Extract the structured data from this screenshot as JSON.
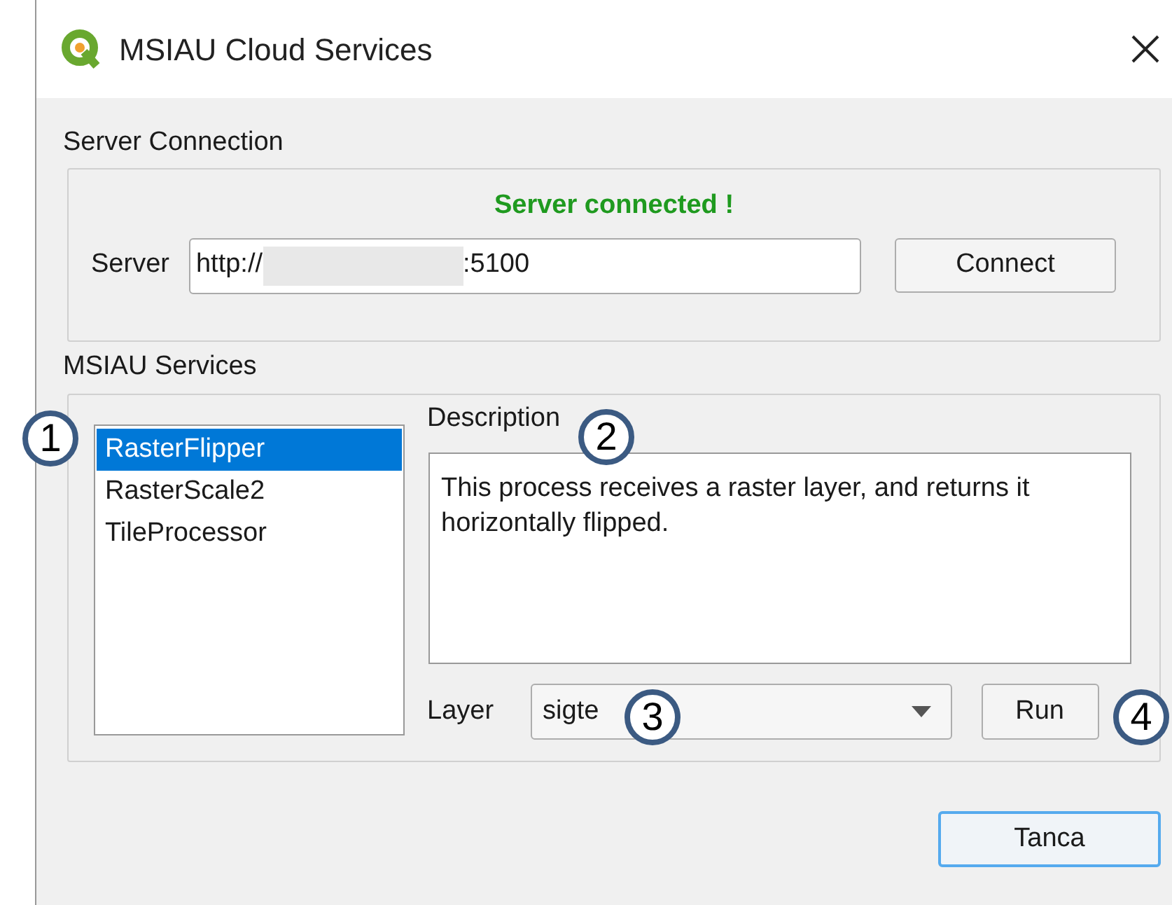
{
  "window": {
    "title": "MSIAU Cloud Services"
  },
  "server_connection": {
    "title": "Server Connection",
    "status": "Server connected !",
    "connected": true,
    "server_label": "Server",
    "server_field": {
      "value_start": "http://",
      "value_end": ":5100"
    },
    "connect_button": "Connect"
  },
  "services": {
    "title": "MSIAU Services",
    "items": [
      {
        "label": "RasterFlipper",
        "selected": true
      },
      {
        "label": "RasterScale2",
        "selected": false
      },
      {
        "label": "TileProcessor",
        "selected": false
      }
    ],
    "description_label": "Description",
    "description": "This process receives a raster layer, and returns it horizontally flipped.",
    "layer_label": "Layer",
    "layer_value": "sigte",
    "run_button": "Run"
  },
  "close_button": "Tanca",
  "callouts": [
    "1",
    "2",
    "3",
    "4"
  ]
}
